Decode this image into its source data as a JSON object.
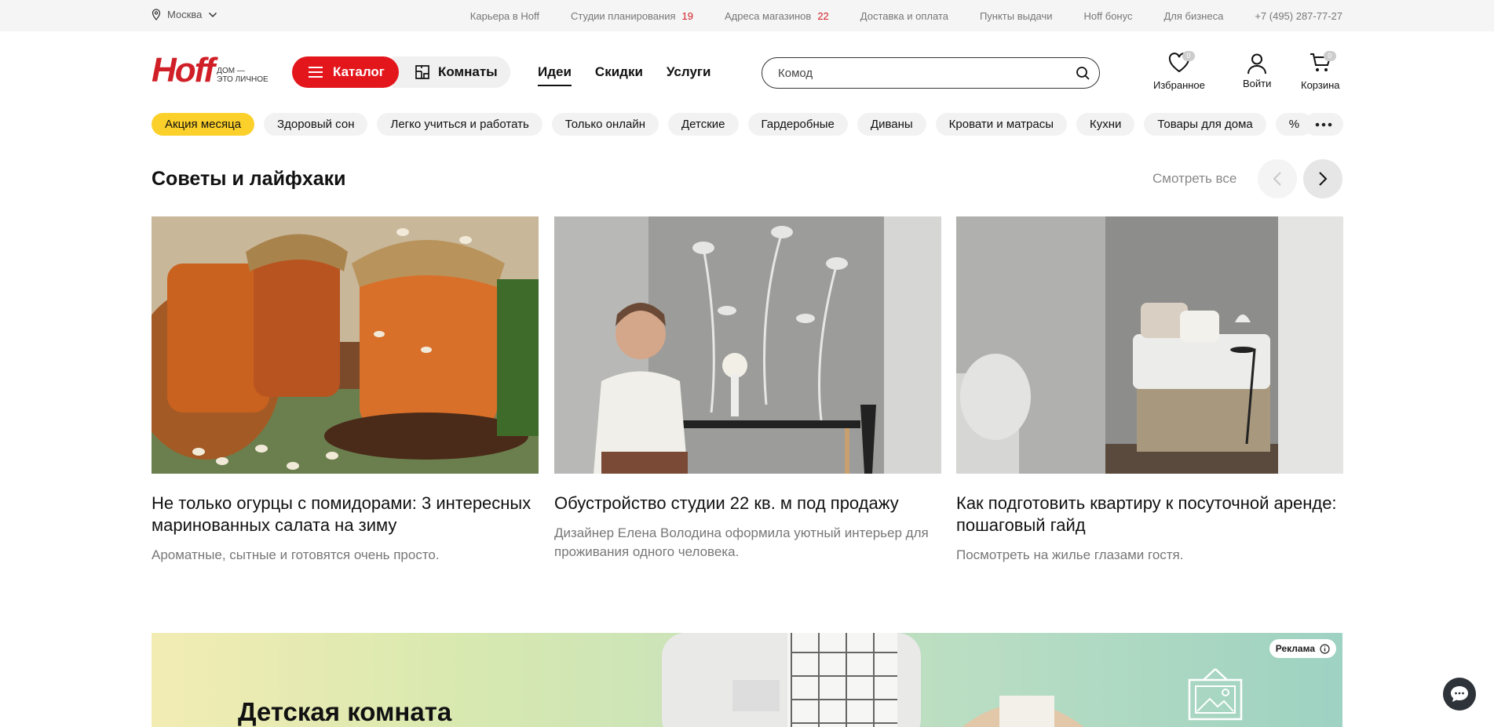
{
  "topbar": {
    "city": "Москва",
    "links": [
      {
        "label": "Карьера в Hoff",
        "count": ""
      },
      {
        "label": "Студии планирования",
        "count": "19"
      },
      {
        "label": "Адреса магазинов",
        "count": "22"
      },
      {
        "label": "Доставка и оплата",
        "count": ""
      },
      {
        "label": "Пункты выдачи",
        "count": ""
      },
      {
        "label": "Hoff бонус",
        "count": ""
      },
      {
        "label": "Для бизнеса",
        "count": ""
      },
      {
        "label": "+7 (495) 287-77-27",
        "count": ""
      }
    ]
  },
  "logo": {
    "word": "Hoff",
    "tagline_1": "ДОМ —",
    "tagline_2": "ЭТО ЛИЧНОЕ"
  },
  "header": {
    "catalog_label": "Каталог",
    "rooms_label": "Комнаты",
    "nav": [
      {
        "label": "Идеи",
        "active": true
      },
      {
        "label": "Скидки",
        "active": false
      },
      {
        "label": "Услуги",
        "active": false
      }
    ],
    "search_placeholder": "Комод",
    "favorites_label": "Избранное",
    "favorites_count": "0",
    "login_label": "Войти",
    "cart_label": "Корзина",
    "cart_count": "0"
  },
  "chips": [
    "Акция месяца",
    "Здоровый сон",
    "Легко учиться и работать",
    "Только онлайн",
    "Детские",
    "Гардеробные",
    "Диваны",
    "Кровати и матрасы",
    "Кухни",
    "Товары для дома",
    "%"
  ],
  "section": {
    "title": "Советы и лайфхаки",
    "see_all": "Смотреть все"
  },
  "cards": [
    {
      "title": "Не только огурцы с помидорами: 3 интересных маринованных салата на зиму",
      "desc": "Ароматные, сытные и готовятся очень просто."
    },
    {
      "title": "Обустройство студии 22 кв. м под продажу",
      "desc": "Дизайнер Елена Володина оформила уютный интерьер для проживания одного человека."
    },
    {
      "title": "Как подготовить квартиру к посуточной аренде: пошаговый гайд",
      "desc": "Посмотреть на жилье глазами гостя."
    }
  ],
  "promo": {
    "title": "Детская комната",
    "ad_label": "Реклама"
  },
  "colors": {
    "brand_red": "#e3161c",
    "accent_yellow": "#fcd02a"
  }
}
